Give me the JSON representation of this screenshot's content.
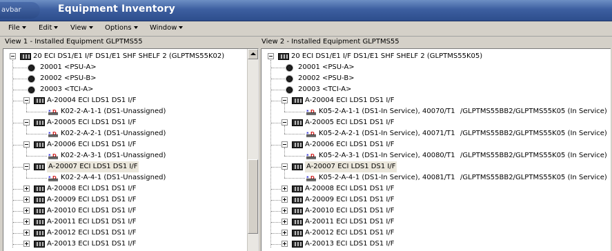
{
  "window": {
    "navbar_label": "avbar",
    "title": "Equipment Inventory"
  },
  "menu": [
    "File",
    "Edit",
    "View",
    "Options",
    "Window"
  ],
  "views": {
    "left_label": "View 1 - Installed Equipment  GLPTMS55",
    "right_label": "View 2 - Installed Equipment  GLPTMS55"
  },
  "left_tree": {
    "shelf": "20 ECI DS1/E1 I/F DS1/E1 SHF SHELF 2  (GLPTMS55K02)",
    "items": [
      {
        "kind": "dot",
        "label": "20001 <PSU-A>"
      },
      {
        "kind": "dot",
        "label": "20002 <PSU-B>"
      },
      {
        "kind": "dot",
        "label": "20003 <TCI-A>"
      },
      {
        "kind": "card",
        "expanded": true,
        "label": "A-20004 ECI LDS1 DS1 I/F"
      },
      {
        "kind": "port",
        "label": "K02-2-A-1-1 (DS1-Unassigned)"
      },
      {
        "kind": "card",
        "expanded": true,
        "label": "A-20005 ECI LDS1 DS1 I/F"
      },
      {
        "kind": "port",
        "label": "K02-2-A-2-1 (DS1-Unassigned)"
      },
      {
        "kind": "card",
        "expanded": true,
        "label": "A-20006 ECI LDS1 DS1 I/F"
      },
      {
        "kind": "port",
        "label": "K02-2-A-3-1 (DS1-Unassigned)"
      },
      {
        "kind": "card",
        "expanded": true,
        "selected": true,
        "label": "A-20007 ECI LDS1 DS1 I/F"
      },
      {
        "kind": "port",
        "label": "K02-2-A-4-1 (DS1-Unassigned)"
      },
      {
        "kind": "card",
        "expanded": false,
        "label": "A-20008 ECI LDS1 DS1 I/F"
      },
      {
        "kind": "card",
        "expanded": false,
        "label": "A-20009 ECI LDS1 DS1 I/F"
      },
      {
        "kind": "card",
        "expanded": false,
        "label": "A-20010 ECI LDS1 DS1 I/F"
      },
      {
        "kind": "card",
        "expanded": false,
        "label": "A-20011 ECI LDS1 DS1 I/F"
      },
      {
        "kind": "card",
        "expanded": false,
        "label": "A-20012 ECI LDS1 DS1 I/F"
      },
      {
        "kind": "card",
        "expanded": false,
        "label": "A-20013 ECI LDS1 DS1 I/F"
      }
    ]
  },
  "right_tree": {
    "shelf": "20 ECI DS1/E1 I/F DS1/E1 SHF SHELF 2  (GLPTMS55K05)",
    "items": [
      {
        "kind": "dot",
        "label": "20001 <PSU-A>"
      },
      {
        "kind": "dot",
        "label": "20002 <PSU-B>"
      },
      {
        "kind": "dot",
        "label": "20003 <TCI-A>"
      },
      {
        "kind": "card",
        "expanded": true,
        "label": "A-20004 ECI LDS1 DS1 I/F"
      },
      {
        "kind": "port",
        "label": "K05-2-A-1-1 (DS1-In Service), 40070/T1",
        "extra": "/GLPTMS55BB2/GLPTMS55K05 (In Service)"
      },
      {
        "kind": "card",
        "expanded": true,
        "label": "A-20005 ECI LDS1 DS1 I/F"
      },
      {
        "kind": "port",
        "label": "K05-2-A-2-1 (DS1-In Service), 40071/T1",
        "extra": "/GLPTMS55BB2/GLPTMS55K05 (In Service)"
      },
      {
        "kind": "card",
        "expanded": true,
        "label": "A-20006 ECI LDS1 DS1 I/F"
      },
      {
        "kind": "port",
        "label": "K05-2-A-3-1 (DS1-In Service), 40080/T1",
        "extra": "/GLPTMS55BB2/GLPTMS55K05 (In Service)"
      },
      {
        "kind": "card",
        "expanded": true,
        "selected": true,
        "label": "A-20007 ECI LDS1 DS1 I/F"
      },
      {
        "kind": "port",
        "label": "K05-2-A-4-1 (DS1-In Service), 40081/T1",
        "extra": "/GLPTMS55BB2/GLPTMS55K05 (In Service)"
      },
      {
        "kind": "card",
        "expanded": false,
        "label": "A-20008 ECI LDS1 DS1 I/F"
      },
      {
        "kind": "card",
        "expanded": false,
        "label": "A-20009 ECI LDS1 DS1 I/F"
      },
      {
        "kind": "card",
        "expanded": false,
        "label": "A-20010 ECI LDS1 DS1 I/F"
      },
      {
        "kind": "card",
        "expanded": false,
        "label": "A-20011 ECI LDS1 DS1 I/F"
      },
      {
        "kind": "card",
        "expanded": false,
        "label": "A-20012 ECI LDS1 DS1 I/F"
      },
      {
        "kind": "card",
        "expanded": false,
        "label": "A-20013 ECI LDS1 DS1 I/F"
      }
    ]
  }
}
